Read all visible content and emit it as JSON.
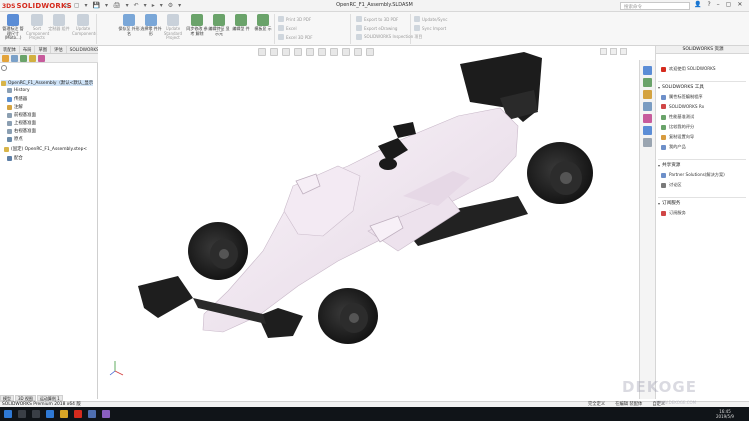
{
  "app": {
    "brand": "SOLIDWORKS",
    "brand_prefix": "3DS",
    "document_title": "OpenRC_F1_Assembly.SLDASM",
    "search_placeholder": "搜索命令",
    "quick_access": [
      "⌂",
      "▢",
      "▾",
      "💾",
      "▾",
      "🖨",
      "▾",
      "↶",
      "▾",
      "▸",
      "▾",
      "⚙",
      "▾"
    ]
  },
  "ribbon": {
    "buttons": [
      {
        "label": "管理标注 管理尺寸 (Moto...)",
        "color": "#5b8dd6",
        "dim": false
      },
      {
        "label": "Sort Component Projects",
        "color": "#c9d1da",
        "dim": true
      },
      {
        "label": "定制器 组件",
        "color": "#c9d1da",
        "dim": true
      },
      {
        "label": "Update Components",
        "color": "#c9d1da",
        "dim": true
      },
      {
        "label": "保存至 外形名",
        "color": "#7aa7d8",
        "dim": false
      },
      {
        "label": "选择零 件外形",
        "color": "#7aa7d8",
        "dim": false
      },
      {
        "label": "Update Standard Project",
        "color": "#c9d1da",
        "dim": true
      },
      {
        "label": "同步修改 参考 解除",
        "color": "#6aa36a",
        "dim": false
      },
      {
        "label": "编辑特征 显示元",
        "color": "#6aa36a",
        "dim": false
      },
      {
        "label": "编辑型 件",
        "color": "#6aa36a",
        "dim": false
      },
      {
        "label": "模板显 示",
        "color": "#6aa36a",
        "dim": false
      }
    ],
    "small_items": [
      "Print 3D PDF",
      "Excel",
      "Excel 3D PDF",
      "Export to 3D PDF",
      "Export eDrawing",
      "SOLIDWORKS Inspection 项目",
      "Update/Sync",
      "Sync Import"
    ]
  },
  "tabs": [
    "装配体",
    "布局",
    "草图",
    "评估",
    "SOLIDWORKS 插件",
    "SOLIDWORKS MBD",
    "SOLIDWORKS Inspection"
  ],
  "feature_tree": {
    "root": "OpenRC_F1_Assembly（默认<默认_显示",
    "items": [
      {
        "label": "History",
        "color": "#8ba0b5"
      },
      {
        "label": "传感器",
        "color": "#5a8fd0"
      },
      {
        "label": "注解",
        "color": "#d4a340"
      },
      {
        "label": "前视基准面",
        "color": "#8b9fb2"
      },
      {
        "label": "上视基准面",
        "color": "#8b9fb2"
      },
      {
        "label": "右视基准面",
        "color": "#8b9fb2"
      },
      {
        "label": "原点",
        "color": "#6a8aa8"
      },
      {
        "label": "(固定) OpenRC_F1_Assembly.step<",
        "color": "#d8b54a"
      },
      {
        "label": "配合",
        "color": "#5d7fa7"
      }
    ]
  },
  "bottom_tabs": [
    "模型",
    "3D 视图",
    "运动算例 1"
  ],
  "status": {
    "left": "SOLIDWORKS Premium 2018 x64 版",
    "right": [
      "完全定义",
      "在编辑 装配体",
      "自定义"
    ]
  },
  "task_pane": {
    "title": "SOLIDWORKS 资源",
    "welcome": "欢迎使用 SOLIDWORKS",
    "sections": [
      {
        "title": "SOLIDWORKS 工具",
        "items": [
          {
            "label": "属性标签编制程序",
            "color": "#6d8fc9"
          },
          {
            "label": "SOLIDWORKS Rx",
            "color": "#d04646"
          },
          {
            "label": "性能基准测试",
            "color": "#6aa36a"
          },
          {
            "label": "比较我的评分",
            "color": "#6aa36a"
          },
          {
            "label": "复制设置向导",
            "color": "#d79b3f"
          },
          {
            "label": "我的产品",
            "color": "#6d8fc9"
          }
        ]
      },
      {
        "title": "共享资源",
        "items": [
          {
            "label": "Partner Solutions(解决方案)",
            "color": "#6d8fc9"
          },
          {
            "label": "讨论区",
            "color": "#7a7a7a"
          }
        ]
      },
      {
        "title": "订阅服务",
        "items": [
          {
            "label": "订阅服务",
            "color": "#d04646"
          }
        ]
      }
    ]
  },
  "taskbar": {
    "time": "16:45",
    "date": "2019/5/9"
  },
  "watermark": {
    "main": "DEKOGE",
    "sub": "WWW.DEKOGE.COM"
  },
  "colors": {
    "body": "#f6eef6",
    "body_shade": "#ddd0dd",
    "carbon": "#1e1e1e",
    "tire": "#202020"
  }
}
